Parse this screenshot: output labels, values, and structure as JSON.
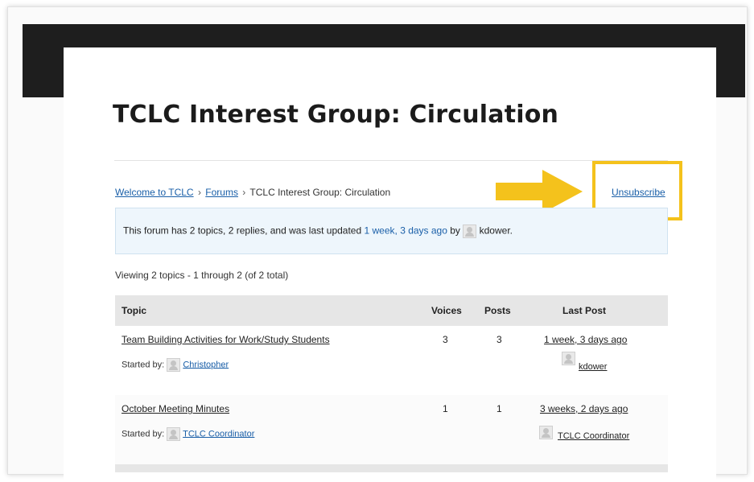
{
  "page": {
    "title": "TCLC Interest Group: Circulation"
  },
  "breadcrumb": {
    "home": "Welcome to TCLC",
    "separator": "›",
    "forums": "Forums",
    "current": "TCLC Interest Group: Circulation"
  },
  "actions": {
    "unsubscribe": "Unsubscribe"
  },
  "info": {
    "text_before": "This forum has 2 topics, 2 replies, and was last updated",
    "last_updated": "1 week, 3 days ago",
    "by": "by",
    "user": "kdower."
  },
  "viewing": "Viewing 2 topics - 1 through 2 (of 2 total)",
  "table": {
    "headers": {
      "topic": "Topic",
      "voices": "Voices",
      "posts": "Posts",
      "last_post": "Last Post"
    },
    "rows": [
      {
        "title": "Team Building Activities for Work/Study Students",
        "started_by_label": "Started by:",
        "author": "Christopher",
        "voices": "3",
        "posts": "3",
        "last_post_time": "1 week, 3 days ago",
        "last_post_user": "kdower"
      },
      {
        "title": "October Meeting Minutes",
        "started_by_label": "Started by:",
        "author": "TCLC Coordinator",
        "voices": "1",
        "posts": "1",
        "last_post_time": "3 weeks, 2 days ago",
        "last_post_user": "TCLC Coordinator"
      }
    ]
  },
  "colors": {
    "link": "#1a5fa8",
    "highlight": "#f4c21c",
    "info_bg": "#eef6fc",
    "header_bar": "#1e1e1e"
  },
  "icons": {
    "arrow": "right-arrow-annotation-icon",
    "avatar": "default-avatar-icon"
  }
}
